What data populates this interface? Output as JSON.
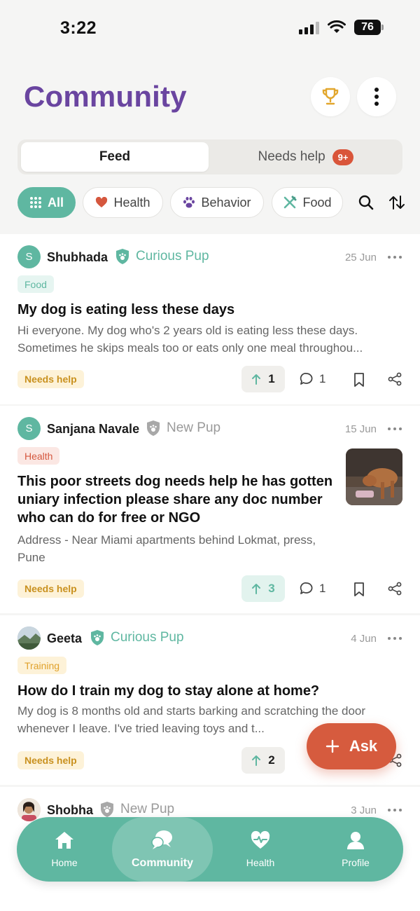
{
  "status_bar": {
    "time": "3:22",
    "battery": "76"
  },
  "header": {
    "title": "Community"
  },
  "tabs": {
    "feed": "Feed",
    "needs_help": "Needs help",
    "needs_help_badge": "9+"
  },
  "filters": [
    {
      "label": "All",
      "icon": "grid-icon",
      "selected": true
    },
    {
      "label": "Health",
      "icon": "heart-icon"
    },
    {
      "label": "Behavior",
      "icon": "paw-icon"
    },
    {
      "label": "Food",
      "icon": "utensils-icon"
    }
  ],
  "posts": [
    {
      "avatar_letter": "S",
      "author": "Shubhada",
      "rank": "Curious Pup",
      "date": "25 Jun",
      "tag": "Food",
      "title": "My dog is eating less these days",
      "body": "Hi everyone. My dog who's 2 years old is eating less these days. Sometimes he skips meals too or eats only one meal throughou...",
      "status": "Needs help",
      "votes": "1",
      "comments": "1"
    },
    {
      "avatar_letter": "S",
      "author": "Sanjana Navale",
      "rank": "New Pup",
      "date": "15 Jun",
      "tag": "Health",
      "title": "This poor streets dog needs help he has gotten uniary infection please share any doc number who can do for free or NGO",
      "body": "Address - Near Miami apartments behind Lokmat, press, Pune",
      "status": "Needs help",
      "votes": "3",
      "comments": "1"
    },
    {
      "author": "Geeta",
      "rank": "Curious Pup",
      "date": "4 Jun",
      "tag": "Training",
      "title": "How do I train my dog to stay alone at home?",
      "body": "My dog is 8 months old and starts barking and scratching the door whenever I leave. I've tried leaving toys and t...",
      "status": "Needs help",
      "votes": "2",
      "comments": ""
    },
    {
      "author": "Shobha",
      "rank": "New Pup",
      "date": "3 Jun"
    }
  ],
  "fab": {
    "label": "Ask"
  },
  "nav": {
    "home": "Home",
    "community": "Community",
    "health": "Health",
    "profile": "Profile"
  },
  "colors": {
    "brand_purple": "#6a45a0",
    "teal": "#5fb7a1",
    "ask_orange": "#d65b3e",
    "needs_help_yellow": "#fdf2d8"
  }
}
